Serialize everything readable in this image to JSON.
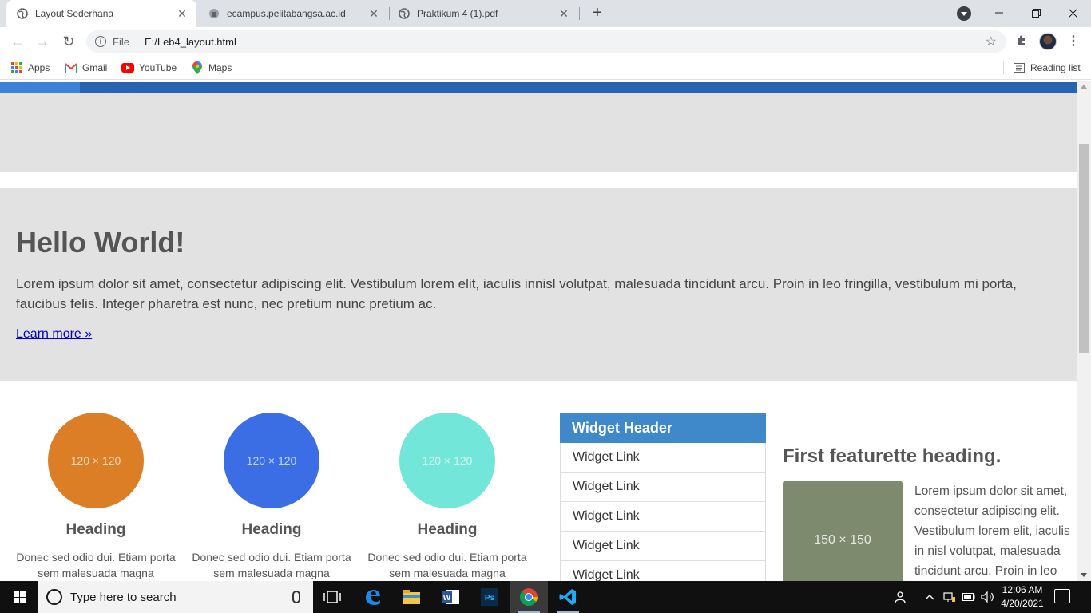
{
  "browser": {
    "tabs": [
      {
        "title": "Layout Sederhana",
        "active": true
      },
      {
        "title": "ecampus.pelitabangsa.ac.id",
        "active": false
      },
      {
        "title": "Praktikum 4 (1).pdf",
        "active": false
      }
    ],
    "new_tab_symbol": "+",
    "address": {
      "scheme_label": "File",
      "url": "E:/Leb4_layout.html"
    },
    "bookmarks": [
      {
        "label": "Apps",
        "icon": "apps-grid-icon"
      },
      {
        "label": "Gmail",
        "icon": "gmail-icon"
      },
      {
        "label": "YouTube",
        "icon": "youtube-icon"
      },
      {
        "label": "Maps",
        "icon": "maps-icon"
      }
    ],
    "reading_list": "Reading list"
  },
  "page": {
    "jumbotron": {
      "heading": "Hello World!",
      "text": "Lorem ipsum dolor sit amet, consectetur adipiscing elit. Vestibulum lorem elit, iaculis innisl volutpat, malesuada tincidunt arcu. Proin in leo fringilla, vestibulum mi porta, faucibus felis. Integer pharetra est nunc, nec pretium nunc pretium ac.",
      "link": "Learn more »"
    },
    "features": [
      {
        "placeholder": "120 × 120",
        "heading": "Heading",
        "text": "Donec sed odio dui. Etiam porta sem malesuada magna",
        "color": "#dc7e26"
      },
      {
        "placeholder": "120 × 120",
        "heading": "Heading",
        "text": "Donec sed odio dui. Etiam porta sem malesuada magna",
        "color": "#3b6ee5"
      },
      {
        "placeholder": "120 × 120",
        "heading": "Heading",
        "text": "Donec sed odio dui. Etiam porta sem malesuada magna",
        "color": "#72e6d8"
      }
    ],
    "widget": {
      "header": "Widget Header",
      "links": [
        "Widget Link",
        "Widget Link",
        "Widget Link",
        "Widget Link",
        "Widget Link"
      ]
    },
    "featurette": {
      "heading": "First featurette heading.",
      "image_placeholder": "150 × 150",
      "text": "Lorem ipsum dolor sit amet, consectetur adipiscing elit. Vestibulum lorem elit, iaculis in nisl volutpat, malesuada tincidunt arcu. Proin in leo"
    }
  },
  "taskbar": {
    "search_placeholder": "Type here to search",
    "clock_time": "12:06 AM",
    "clock_date": "4/20/2021"
  },
  "colors": {
    "navbar": "#2765b2",
    "widget_header": "#3f88c9",
    "featurette_image": "#7d8a6e"
  }
}
